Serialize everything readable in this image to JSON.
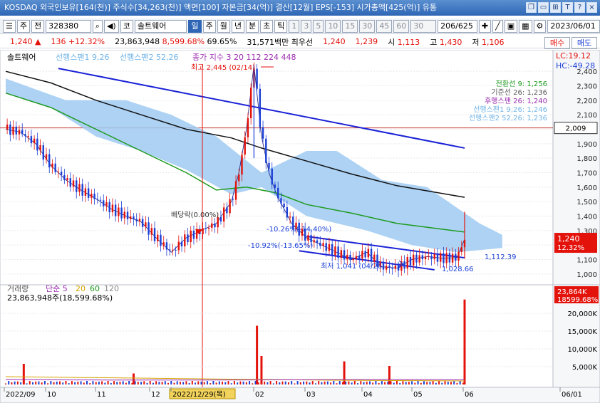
{
  "titlebar": {
    "text": "KOSDAQ 외국인보유[164(천)] 주식수[34,263(천)] 액면[100] 자본금[34(억)] 결산[12월] EPS[-153] 시가총액[425(억)] 유통",
    "icons": [
      "restore-icon",
      "minimize-icon",
      "pin-icon",
      "text-icon",
      "help-icon",
      "close-icon"
    ]
  },
  "toolbar": {
    "market_label": "주",
    "prev_label": "전",
    "code": "328380",
    "type_label": "코",
    "stock_name": "솔트웨어",
    "periods": [
      "일",
      "주",
      "월",
      "년",
      "분",
      "초",
      "틱"
    ],
    "selected_period": "일",
    "intervals": [
      "1",
      "3",
      "5",
      "10",
      "15",
      "30",
      "45",
      "60"
    ],
    "interval_value": "30",
    "page_count": "206/625",
    "date": "2023/06/01"
  },
  "info": {
    "price": "1,240",
    "change": "136 +12.32%",
    "volume": "23,863,948",
    "volume_pct": "8,599.68%",
    "turnover": "69.65%",
    "amount": "31,571백만",
    "best_ask_label": "최우선",
    "best_ask": "1,240",
    "best_bid": "1,239",
    "open_label": "시",
    "open": "1,113",
    "high_label": "고",
    "high": "1,430",
    "low_label": "저",
    "low": "1,106",
    "buy_label": "매수",
    "sell_label": "매도"
  },
  "colors": {
    "up": "#e3120b",
    "down": "#1a3fd6",
    "cloud": "#9fcaf2",
    "ma_green": "#1e9a1e",
    "ma_black": "#111111",
    "trend_blue": "#1a22d6"
  },
  "chart_data": {
    "type": "line",
    "title": "솔트웨어",
    "legend": [
      {
        "name": "선행스팬1 9,26",
        "color": "#6fb3e8"
      },
      {
        "name": "선행스팬2 52,26",
        "color": "#6fb3e8"
      }
    ],
    "top_legend": "종가 지수 3  20  112  224  448",
    "right_legend": [
      "전환선 9: 1,256",
      "기준선 26: 1,236",
      "후행스팬 26: 1,240",
      "선행스팬1 9,26: 1,246",
      "선행스팬2 52,26: 1,236"
    ],
    "lc_label": "LC:19.12",
    "hc_label": "HC:-49.28",
    "ylim": [
      950,
      2450
    ],
    "y_ticks": [
      1000,
      1100,
      1200,
      1300,
      1400,
      1500,
      1600,
      1700,
      1800,
      1900,
      2000,
      2100,
      2200,
      2300,
      2400
    ],
    "y_tick_labels": [
      "1,000",
      "1,100",
      "1,200",
      "1,300",
      "1,400",
      "1,500",
      "1,600",
      "1,700",
      "1,800",
      "1,900",
      "2,000",
      "2,100",
      "2,200",
      "2,300",
      "2,400"
    ],
    "hline_value": 2009,
    "hline_label": "2,009",
    "last_price_label": "1,240",
    "last_change_label": "12.32%",
    "x_date_labels": [
      "2022/09",
      "10",
      "11",
      "12",
      "2022/12/29(목)",
      "02",
      "03",
      "04",
      "05",
      "06",
      "06/01"
    ],
    "annotations": {
      "high": "최고 2,445 (02/14)",
      "low": "최저 1,041 (04/26)",
      "ex_dividend": "배당락(0.00%)",
      "pct1": "-10.26%(-14.40%)",
      "pct2": "-10.92%(-13.65%)",
      "trend_end1": "1,112.39",
      "trend_end2": "1,028.66"
    },
    "series": [
      {
        "name": "종가",
        "x": [
          0,
          10,
          20,
          30,
          40,
          50,
          60,
          70,
          80,
          90,
          100,
          110,
          120,
          130,
          140,
          150,
          155,
          160,
          165,
          170,
          175,
          180,
          185,
          190,
          200,
          210,
          220,
          230,
          240,
          250,
          260,
          270,
          280,
          290,
          300,
          305
        ],
        "values": [
          2000,
          1980,
          1900,
          1750,
          1650,
          1580,
          1520,
          1450,
          1400,
          1360,
          1250,
          1150,
          1250,
          1300,
          1350,
          1500,
          1700,
          2000,
          2445,
          1950,
          1700,
          1550,
          1450,
          1350,
          1250,
          1200,
          1150,
          1100,
          1150,
          1050,
          1041,
          1100,
          1120,
          1110,
          1113,
          1240
        ]
      },
      {
        "name": "112",
        "x": [
          0,
          30,
          60,
          90,
          120,
          140,
          160,
          180,
          200,
          230,
          260,
          305
        ],
        "values": [
          2250,
          2150,
          2000,
          1850,
          1700,
          1580,
          1600,
          1560,
          1480,
          1420,
          1350,
          1290
        ]
      },
      {
        "name": "224",
        "x": [
          0,
          30,
          60,
          90,
          120,
          150,
          170,
          200,
          230,
          260,
          305
        ],
        "values": [
          2400,
          2320,
          2200,
          2100,
          2000,
          1940,
          1870,
          1780,
          1690,
          1610,
          1530
        ]
      }
    ],
    "volume": {
      "label": "거래량",
      "legend": [
        "단순 5",
        "20",
        "60",
        "120"
      ],
      "current": "23,863,948주(18,599.68%)",
      "current_box": "23,864K",
      "current_box_pct": "18599.68%",
      "ylim": [
        0,
        25000
      ],
      "y_ticks": [
        5000,
        10000,
        15000,
        20000
      ],
      "y_tick_labels": [
        "5,000K",
        "10,000K",
        "15,000K",
        "20,000K"
      ],
      "spikes": [
        {
          "x": 12,
          "v": 5800
        },
        {
          "x": 85,
          "v": 3100
        },
        {
          "x": 167,
          "v": 16500
        },
        {
          "x": 170,
          "v": 8000
        },
        {
          "x": 225,
          "v": 6500
        },
        {
          "x": 255,
          "v": 5200
        },
        {
          "x": 305,
          "v": 23864
        }
      ]
    }
  }
}
